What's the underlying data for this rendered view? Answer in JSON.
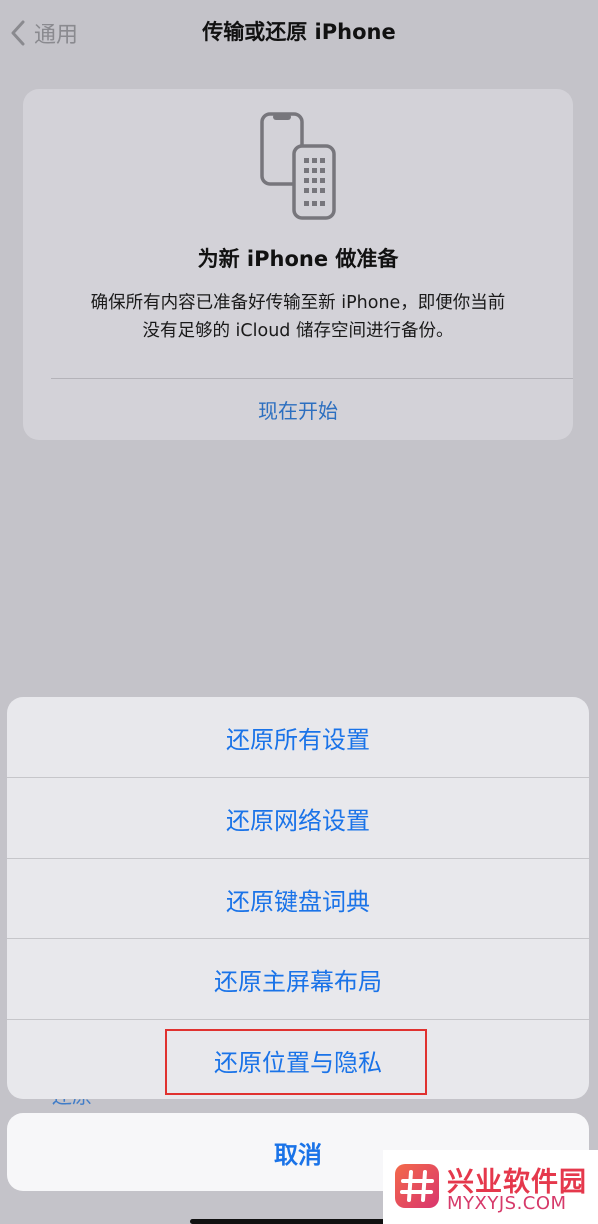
{
  "nav": {
    "back_label": "通用",
    "title": "传输或还原 iPhone"
  },
  "card": {
    "title": "为新 iPhone 做准备",
    "description_line1": "确保所有内容已准备好传输至新 iPhone，即便你当前",
    "description_line2": "没有足够的 iCloud 储存空间进行备份。",
    "action_label": "现在开始"
  },
  "peek_text": "还原",
  "sheet": {
    "items": [
      {
        "label": "还原所有设置"
      },
      {
        "label": "还原网络设置"
      },
      {
        "label": "还原键盘词典"
      },
      {
        "label": "还原主屏幕布局"
      },
      {
        "label": "还原位置与隐私"
      }
    ],
    "cancel_label": "取消"
  },
  "watermark": {
    "name": "兴业软件园",
    "url": "MYXYJS.COM"
  },
  "colors": {
    "accent": "#1a73e8",
    "highlight_border": "#e0312f",
    "background_dim": "#c4c3c9"
  }
}
